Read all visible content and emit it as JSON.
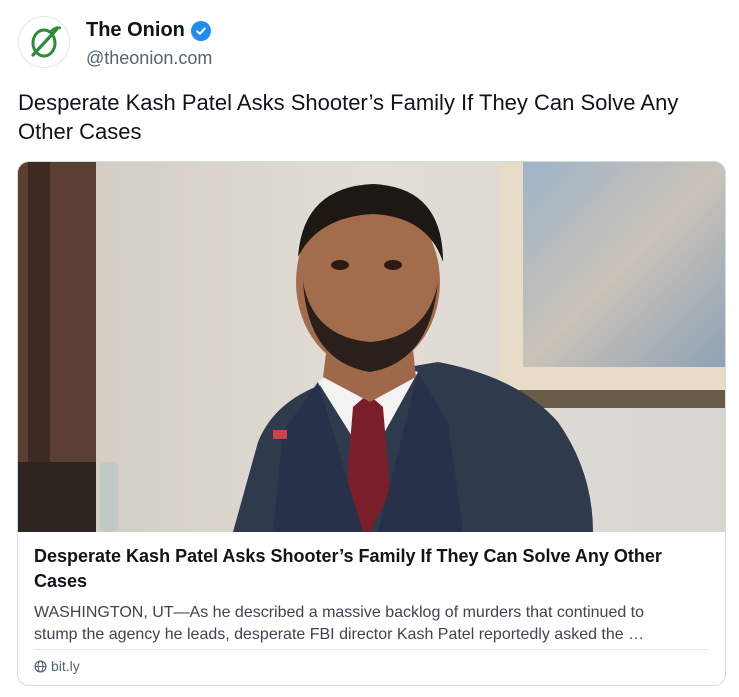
{
  "author": {
    "display_name": "The Onion",
    "handle": "@theonion.com",
    "verified_icon": "verified-check-icon",
    "avatar_icon": "onion-logo-icon",
    "brand_color": "#2e8b3c",
    "verified_color": "#1d8ef0"
  },
  "post": {
    "text": "Desperate Kash Patel Asks Shooter’s Family If They Can Solve Any Other Cases"
  },
  "link_card": {
    "image_icon": "article-photo",
    "title": "Desperate Kash Patel Asks Shooter’s Family If They Can Solve Any Other Cases",
    "description_line_1": "WASHINGTON, UT—As he described a massive backlog of murders that continued to",
    "description_line_2": "stump the agency he leads, desperate FBI director Kash Patel reportedly asked the …",
    "domain": "bit.ly",
    "domain_icon": "globe-icon"
  }
}
